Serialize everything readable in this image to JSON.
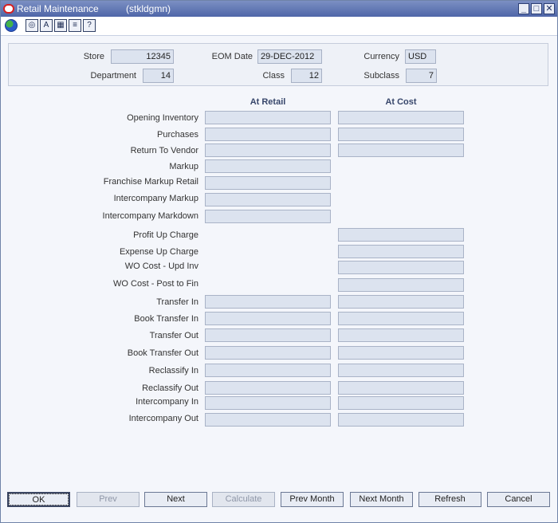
{
  "window": {
    "title": "Retail Maintenance",
    "context": "(stkldgmn)"
  },
  "toolbar": {
    "icons": [
      "globe-icon",
      "help-icon",
      "search-icon",
      "calendar-icon",
      "print-icon",
      "question-icon"
    ]
  },
  "header": {
    "store_label": "Store",
    "store_value": "12345",
    "eom_label": "EOM Date",
    "eom_value": "29-DEC-2012",
    "currency_label": "Currency",
    "currency_value": "USD",
    "department_label": "Department",
    "department_value": "14",
    "class_label": "Class",
    "class_value": "12",
    "subclass_label": "Subclass",
    "subclass_value": "7"
  },
  "grid": {
    "col_retail": "At Retail",
    "col_cost": "At Cost",
    "rows": [
      "Opening Inventory",
      "Purchases",
      "Return To Vendor",
      "Markup",
      "Franchise Markup Retail",
      "Intercompany Markup",
      "Intercompany Markdown",
      "Profit Up Charge",
      "Expense Up Charge",
      "WO Cost - Upd Inv",
      "WO Cost - Post to Fin",
      "Transfer In",
      "Book Transfer In",
      "Transfer Out",
      "Book Transfer Out",
      "Reclassify In",
      "Reclassify Out",
      "Intercompany In",
      "Intercompany Out"
    ]
  },
  "buttons": {
    "ok": "OK",
    "prev": "Prev",
    "next": "Next",
    "calculate": "Calculate",
    "prev_month": "Prev Month",
    "next_month": "Next Month",
    "refresh": "Refresh",
    "cancel": "Cancel"
  }
}
